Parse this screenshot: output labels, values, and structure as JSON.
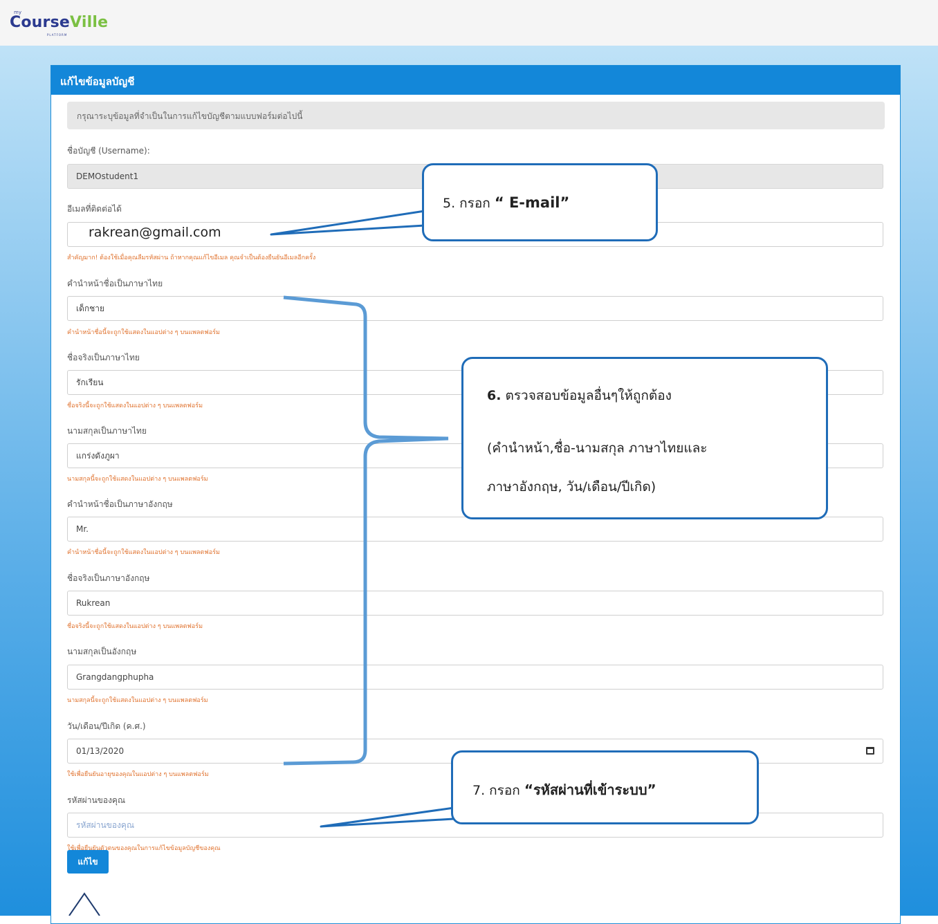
{
  "brand": {
    "my": "my",
    "course": "Course",
    "ville": "Ville",
    "platform": "PLATFORM"
  },
  "panel": {
    "title": "แก้ไขข้อมูลบัญชี",
    "notice": "กรุณาระบุข้อมูลที่จำเป็นในการแก้ไขบัญชีตามแบบฟอร์มต่อไปนี้"
  },
  "form": {
    "username": {
      "label": "ชื่อบัญชี (Username):",
      "value": "DEMOstudent1"
    },
    "email": {
      "label": "อีเมลที่ติดต่อได้",
      "value": "rakrean@gmail.com",
      "help": "สำคัญมาก! ต้องใช้เมื่อคุณลืมรหัสผ่าน ถ้าหากคุณแก้ไขอีเมล คุณจำเป็นต้องยืนยันอีเมลอีกครั้ง"
    },
    "title_th": {
      "label": "คำนำหน้าชื่อเป็นภาษาไทย",
      "value": "เด็กชาย",
      "help": "คำนำหน้าชื่อนี้จะถูกใช้แสดงในแอปต่าง ๆ บนแพลตฟอร์ม"
    },
    "first_th": {
      "label": "ชื่อจริงเป็นภาษาไทย",
      "value": "รักเรียน",
      "help": "ชื่อจริงนี้จะถูกใช้แสดงในแอปต่าง ๆ บนแพลตฟอร์ม"
    },
    "last_th": {
      "label": "นามสกุลเป็นภาษาไทย",
      "value": "แกร่งดังภูผา",
      "help": "นามสกุลนี้จะถูกใช้แสดงในแอปต่าง ๆ บนแพลตฟอร์ม"
    },
    "title_en": {
      "label": "คำนำหน้าชื่อเป็นภาษาอังกฤษ",
      "value": "Mr.",
      "help": "คำนำหน้าชื่อนี้จะถูกใช้แสดงในแอปต่าง ๆ บนแพลตฟอร์ม"
    },
    "first_en": {
      "label": "ชื่อจริงเป็นภาษาอังกฤษ",
      "value": "Rukrean",
      "help": "ชื่อจริงนี้จะถูกใช้แสดงในแอปต่าง ๆ บนแพลตฟอร์ม"
    },
    "last_en": {
      "label": "นามสกุลเป็นอังกฤษ",
      "value": "Grangdangphupha",
      "help": "นามสกุลนี้จะถูกใช้แสดงในแอปต่าง ๆ บนแพลตฟอร์ม"
    },
    "dob": {
      "label": "วัน/เดือน/ปีเกิด (ค.ศ.)",
      "value": "01/13/2020",
      "help": "ใช้เพื่อยืนยันอายุของคุณในแอปต่าง ๆ บนแพลตฟอร์ม"
    },
    "password": {
      "label": "รหัสผ่านของคุณ",
      "placeholder": "รหัสผ่านของคุณ",
      "help": "ใช้เพื่อยืนยันตัวตนของคุณในการแก้ไขข้อมูลบัญชีของคุณ"
    },
    "submit_label": "แก้ไข"
  },
  "annotations": {
    "step5_num": "5",
    "step5_text": ". กรอก ",
    "step5_quoted": "“ E-mail”",
    "step6_num": "6.",
    "step6_line1": " ตรวจสอบข้อมูลอื่นๆให้ถูกต้อง",
    "step6_line2": "(คำนำหน้า,ชื่อ-นามสกุล ภาษาไทยและ",
    "step6_line3": "ภาษาอังกฤษ, วัน/เดือน/ปีเกิด)",
    "step7_num": "7",
    "step7_text": ". กรอก ",
    "step7_quoted": "“รหัสผ่านที่เข้าระบบ”"
  },
  "colors": {
    "header_blue": "#1387d9",
    "help_orange": "#e0722e",
    "callout_border": "#1f6cb8",
    "bracket_blue": "#5b9bd5"
  }
}
